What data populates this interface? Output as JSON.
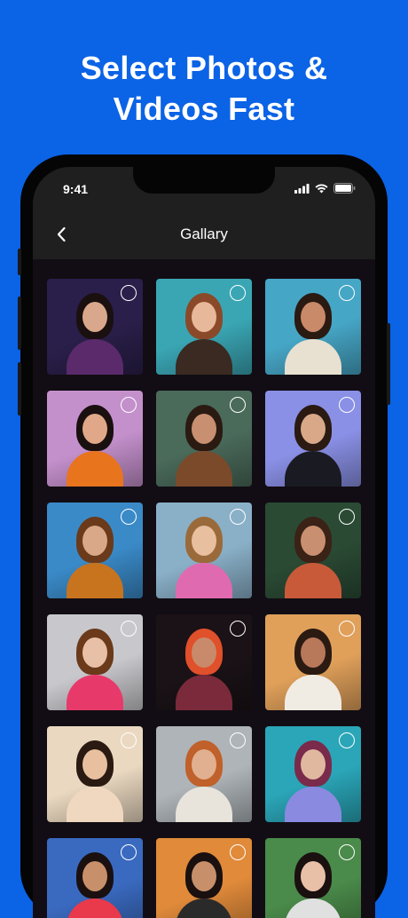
{
  "headline": {
    "line1": "Select Photos &",
    "line2": "Videos Fast"
  },
  "status_bar": {
    "time": "9:41",
    "icons": [
      "signal-icon",
      "wifi-icon",
      "battery-icon"
    ]
  },
  "nav": {
    "back_icon": "chevron-left-icon",
    "title": "Gallary"
  },
  "gallery": {
    "photos": [
      {
        "bg": "#2a1f4a",
        "hair": "#1a1010",
        "skin": "#d9a88c",
        "cloth": "#5a2a6a"
      },
      {
        "bg": "#3aa6b4",
        "hair": "#8a4a2a",
        "skin": "#e8b89a",
        "cloth": "#3a2a22"
      },
      {
        "bg": "#46a6c6",
        "hair": "#2a1a12",
        "skin": "#c98a6a",
        "cloth": "#e8e0d0"
      },
      {
        "bg": "#c490cc",
        "hair": "#1a1010",
        "skin": "#e0a888",
        "cloth": "#e8741e"
      },
      {
        "bg": "#4a6a5a",
        "hair": "#2a1a12",
        "skin": "#c89070",
        "cloth": "#7a4a2a"
      },
      {
        "bg": "#8a90e6",
        "hair": "#2a1a12",
        "skin": "#d8a888",
        "cloth": "#1a1a22"
      },
      {
        "bg": "#3a8ac8",
        "hair": "#6a3a1a",
        "skin": "#d8a888",
        "cloth": "#c8741e"
      },
      {
        "bg": "#8ab0c8",
        "hair": "#9a6a3a",
        "skin": "#e8c0a0",
        "cloth": "#e06ab0"
      },
      {
        "bg": "#2a4a34",
        "hair": "#3a2216",
        "skin": "#c89070",
        "cloth": "#c85a3a"
      },
      {
        "bg": "#c8c8cc",
        "hair": "#6a3a1a",
        "skin": "#e8c0a8",
        "cloth": "#e83a6a"
      },
      {
        "bg": "#1a1216",
        "hair": "#e0502a",
        "skin": "#c88a6a",
        "cloth": "#7a2a3a"
      },
      {
        "bg": "#e0a05a",
        "hair": "#2a1a12",
        "skin": "#b8785a",
        "cloth": "#f0ece4"
      },
      {
        "bg": "#ead8c0",
        "hair": "#2a1a12",
        "skin": "#e8c0a0",
        "cloth": "#f0d8c0"
      },
      {
        "bg": "#aeb4b8",
        "hair": "#c0602a",
        "skin": "#e0b090",
        "cloth": "#e8e4dc"
      },
      {
        "bg": "#2aa6b8",
        "hair": "#7a2a4a",
        "skin": "#e0b8a0",
        "cloth": "#8a8ae0"
      },
      {
        "bg": "#3a6ac0",
        "hair": "#1a1010",
        "skin": "#c8906a",
        "cloth": "#e83a4a"
      },
      {
        "bg": "#e08a3a",
        "hair": "#1a1010",
        "skin": "#c8906a",
        "cloth": "#2a2a2a"
      },
      {
        "bg": "#4a8a4a",
        "hair": "#1a1010",
        "skin": "#e8c0a8",
        "cloth": "#e0e0e0"
      }
    ]
  }
}
